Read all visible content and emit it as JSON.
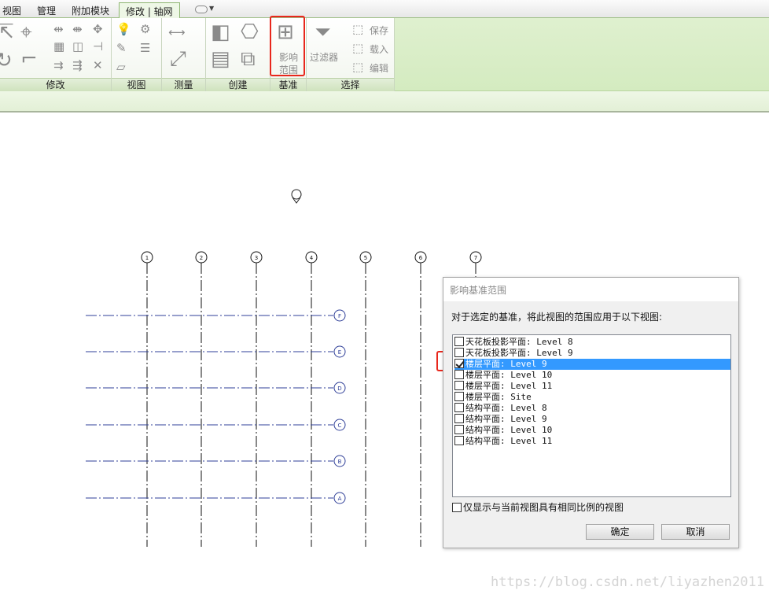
{
  "tabs": [
    {
      "label": "视图",
      "active": false
    },
    {
      "label": "管理",
      "active": false
    },
    {
      "label": "附加模块",
      "active": false
    },
    {
      "label": "修改 | 轴网",
      "active": true
    }
  ],
  "ribbon": {
    "panels": {
      "modify": "修改",
      "view": "视图",
      "measure": "测量",
      "create": "创建",
      "datum": "基准",
      "select": "选择"
    },
    "datum_button_line1": "影响",
    "datum_button_line2": "范围",
    "filter_label": "过滤器",
    "select_save": "保存",
    "select_load": "载入",
    "select_edit": "编辑"
  },
  "grid": {
    "vertical_bubbles": [
      "1",
      "2",
      "3",
      "4",
      "5",
      "6",
      "7"
    ],
    "horizontal_bubbles": [
      "F",
      "E",
      "D",
      "C",
      "B",
      "A"
    ]
  },
  "dialog": {
    "title": "影响基准范围",
    "prompt": "对于选定的基准，将此视图的范围应用于以下视图:",
    "views": [
      {
        "label": "天花板投影平面: Level 8",
        "checked": false,
        "selected": false
      },
      {
        "label": "天花板投影平面: Level 9",
        "checked": false,
        "selected": false
      },
      {
        "label": "楼层平面: Level 9",
        "checked": true,
        "selected": true
      },
      {
        "label": "楼层平面: Level 10",
        "checked": false,
        "selected": false
      },
      {
        "label": "楼层平面: Level 11",
        "checked": false,
        "selected": false
      },
      {
        "label": "楼层平面: Site",
        "checked": false,
        "selected": false
      },
      {
        "label": "结构平面: Level 8",
        "checked": false,
        "selected": false
      },
      {
        "label": "结构平面: Level 9",
        "checked": false,
        "selected": false
      },
      {
        "label": "结构平面: Level 10",
        "checked": false,
        "selected": false
      },
      {
        "label": "结构平面: Level 11",
        "checked": false,
        "selected": false
      }
    ],
    "same_scale_label": "仅显示与当前视图具有相同比例的视图",
    "same_scale_checked": false,
    "ok_label": "确定",
    "cancel_label": "取消"
  },
  "watermark": "https://blog.csdn.net/liyazhen2011",
  "colors": {
    "grid_line": "#2f3f98",
    "highlight": "#e8271c",
    "selection": "#3399ff",
    "ribbon_green": "#dff0cf"
  }
}
